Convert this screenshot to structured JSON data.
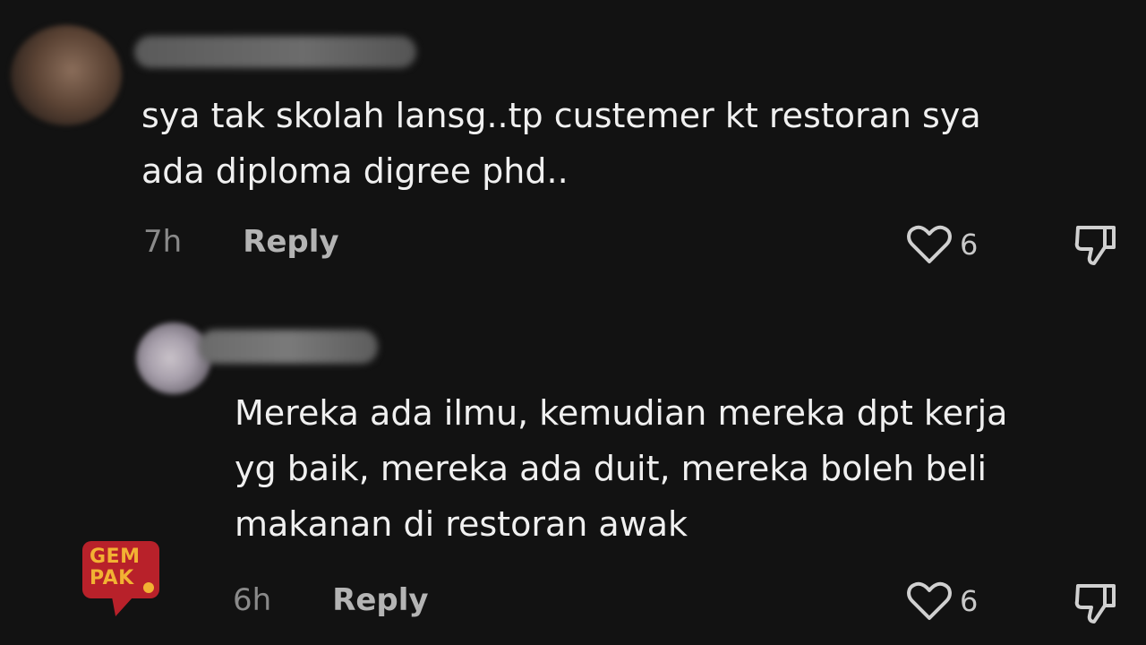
{
  "comments": [
    {
      "text": "sya tak skolah lansg..tp custemer kt restoran sya\nada diploma digree phd..",
      "time": "7h",
      "reply_label": "Reply",
      "likes": "6"
    },
    {
      "text": "Mereka ada ilmu, kemudian mereka dpt kerja\nyg baik, mereka ada duit, mereka boleh beli\nmakanan di restoran awak",
      "time": "6h",
      "reply_label": "Reply",
      "likes": "6"
    }
  ],
  "watermark": {
    "line1": "GEM",
    "line2": "PAK"
  },
  "colors": {
    "background": "#121212",
    "text": "#f0f0f0",
    "muted": "#8a8a8a",
    "logo_red": "#b8212a",
    "logo_yellow": "#f2b233"
  },
  "icons": {
    "like": "heart-icon",
    "dislike": "thumbs-down-icon"
  }
}
